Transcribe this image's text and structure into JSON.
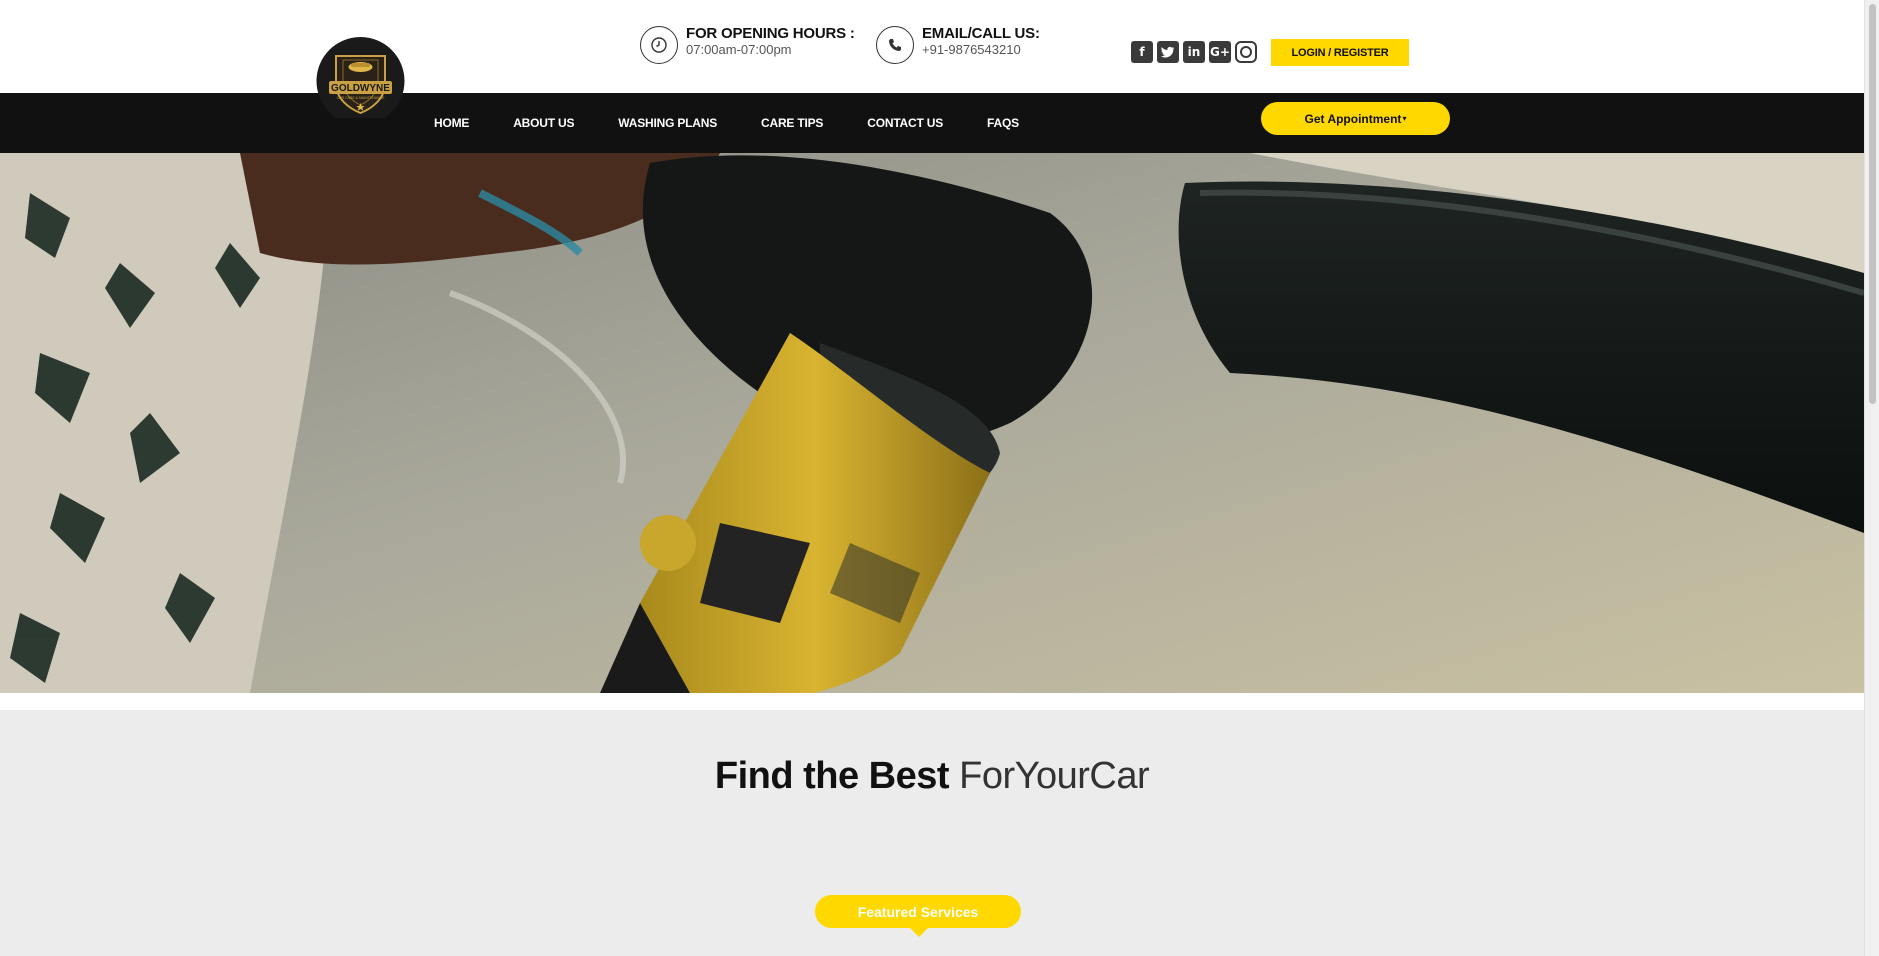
{
  "brand": {
    "name": "GOLDWYNE",
    "tagline": "CAR CARE & MAINTENANCE"
  },
  "topbar": {
    "hours_label": "FOR OPENING HOURS :",
    "hours_value": "07:00am-07:00pm",
    "contact_label": "EMAIL/CALL US:",
    "contact_value": "+91-9876543210",
    "social_icons": [
      "facebook-icon",
      "twitter-icon",
      "linkedin-icon",
      "google-plus-icon",
      "instagram-icon"
    ],
    "login_label": "LOGIN / REGISTER"
  },
  "nav": {
    "items": [
      {
        "label": "HOME"
      },
      {
        "label": "ABOUT US"
      },
      {
        "label": "WASHING PLANS"
      },
      {
        "label": "CARE TIPS"
      },
      {
        "label": "CONTACT US"
      },
      {
        "label": "FAQS"
      }
    ],
    "appointment_label": "Get Appointment",
    "appointment_caret": "▾"
  },
  "section": {
    "title_bold": "Find the Best",
    "title_light": "ForYourCar",
    "featured_label": "Featured Services"
  },
  "colors": {
    "accent": "#ffd800",
    "nav_bg": "#111111",
    "section_bg": "#ececec"
  }
}
